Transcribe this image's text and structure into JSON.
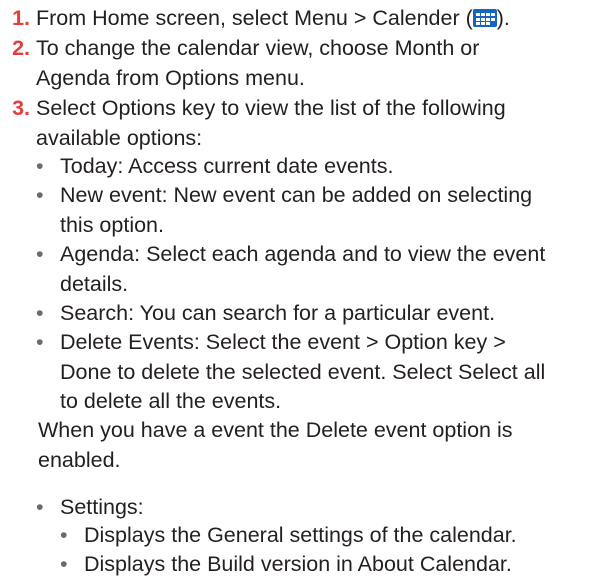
{
  "steps": [
    {
      "number": "1.",
      "text_before_icon": "From Home screen, select Menu > Calender (",
      "icon": "calendar-app-icon",
      "text_after_icon": ").",
      "icon_color": "#1565c0"
    },
    {
      "number": "2.",
      "line1": "To change the calendar view, choose Month or",
      "line2": "Agenda from Options menu."
    },
    {
      "number": "3.",
      "line1": "Select Options key to view the list of the following",
      "line2": "available options:"
    }
  ],
  "options": [
    {
      "lines": [
        "Today: Access current date events."
      ]
    },
    {
      "lines": [
        "New event: New event can be added on selecting",
        "this option."
      ]
    },
    {
      "lines": [
        "Agenda: Select each agenda and to view the event",
        "details."
      ]
    },
    {
      "lines": [
        "Search: You can search for a particular event."
      ]
    },
    {
      "lines": [
        "Delete Events: Select the event > Option key >",
        "Done to delete the selected event. Select Select all",
        "to delete all the events."
      ]
    }
  ],
  "delete_note": {
    "line1": "When you have a event the Delete event option is",
    "line2": "enabled."
  },
  "settings": {
    "label": "Settings:",
    "sub_items": [
      "Displays the General settings of the calendar.",
      "Displays the Build version in About Calendar."
    ]
  },
  "bullet_glyph": "•",
  "colors": {
    "step_number": "#e63c3c",
    "text": "#231f20",
    "bullet": "#6b6b6b"
  }
}
